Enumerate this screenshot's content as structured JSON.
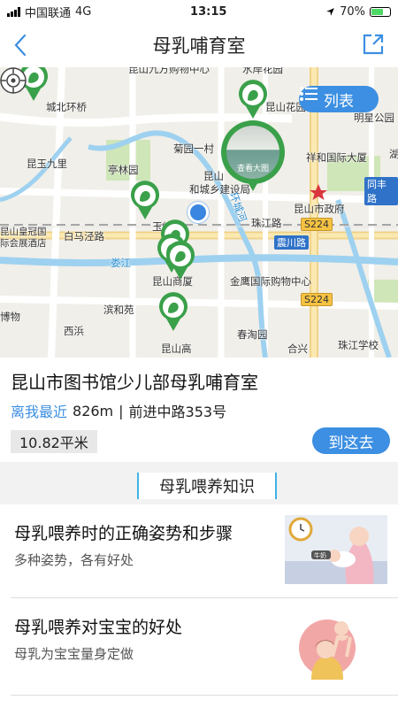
{
  "status": {
    "carrier": "中国联通",
    "network": "4G",
    "time": "13:15",
    "battery": "70%",
    "battery_level": 0.7
  },
  "nav": {
    "title": "母乳哺育室"
  },
  "map": {
    "list_button": "列表",
    "preview_text": "查看大图",
    "labels": [
      {
        "name": "label-kunshan-jiufang",
        "text": "昆山九方购物中心"
      },
      {
        "name": "label-shuiyuan",
        "text": "水岸花园"
      },
      {
        "name": "label-chengbei",
        "text": "城北环桥"
      },
      {
        "name": "label-kunshan-huayuan",
        "text": "昆山花园"
      },
      {
        "name": "label-mingxing",
        "text": "明星公园"
      },
      {
        "name": "label-juyuan",
        "text": "菊园一村"
      },
      {
        "name": "label-tinglin",
        "text": "亭林园"
      },
      {
        "name": "label-xianghe",
        "text": "祥和国际大厦"
      },
      {
        "name": "label-kunshan-jiuli",
        "text": "昆玉九里"
      },
      {
        "name": "label-chengxiang",
        "text": "和城乡建设局"
      },
      {
        "name": "label-kunshan-shizhengfu",
        "text": "昆山市政府"
      },
      {
        "name": "label-kunshan-short",
        "text": "昆山"
      },
      {
        "name": "label-huanhu",
        "text": "环城河"
      },
      {
        "name": "label-zhujiang",
        "text": "珠江路"
      },
      {
        "name": "label-kunshan-huangguan",
        "text": "昆山皇冠国际会展酒店"
      },
      {
        "name": "label-baima",
        "text": "白马泾路"
      },
      {
        "name": "label-yufeng",
        "text": "玉峰"
      },
      {
        "name": "label-loujiang",
        "text": "娄江"
      },
      {
        "name": "label-kunshan-shangxia",
        "text": "昆山商厦"
      },
      {
        "name": "label-jinying",
        "text": "金鹰国际购物中心"
      },
      {
        "name": "label-bowu",
        "text": "博物"
      },
      {
        "name": "label-binhe",
        "text": "滨和苑"
      },
      {
        "name": "label-xibin",
        "text": "西浜"
      },
      {
        "name": "label-chunxu",
        "text": "春淘园"
      },
      {
        "name": "label-kunshan-gao",
        "text": "昆山高"
      },
      {
        "name": "label-hexing",
        "text": "合兴"
      },
      {
        "name": "label-zhujiang-school",
        "text": "珠江学校"
      },
      {
        "name": "label-lianhu",
        "text": "湖滨"
      }
    ],
    "road_badges": [
      {
        "name": "road-tongfeng",
        "text": "同丰路"
      },
      {
        "name": "road-zhenchuan",
        "text": "震川路"
      }
    ],
    "highway_badges": [
      "S224",
      "S224"
    ]
  },
  "place": {
    "name": "昆山市图书馆少儿部母乳哺育室",
    "nearest_label": "离我最近",
    "distance": "826m",
    "separator": "|",
    "address": "前进中路353号",
    "area": "10.82平米",
    "go_button": "到这去"
  },
  "knowledge": {
    "section_title": "母乳喂养知识",
    "articles": [
      {
        "title": "母乳喂养时的正确姿势和步骤",
        "subtitle": "多种姿势，各有好处",
        "thumb_badge": "牛奶"
      },
      {
        "title": "母乳喂养对宝宝的好处",
        "subtitle": "母乳为宝宝量身定做"
      }
    ]
  },
  "colors": {
    "accent": "#3c8fe2",
    "pin_green": "#3aa04a"
  }
}
